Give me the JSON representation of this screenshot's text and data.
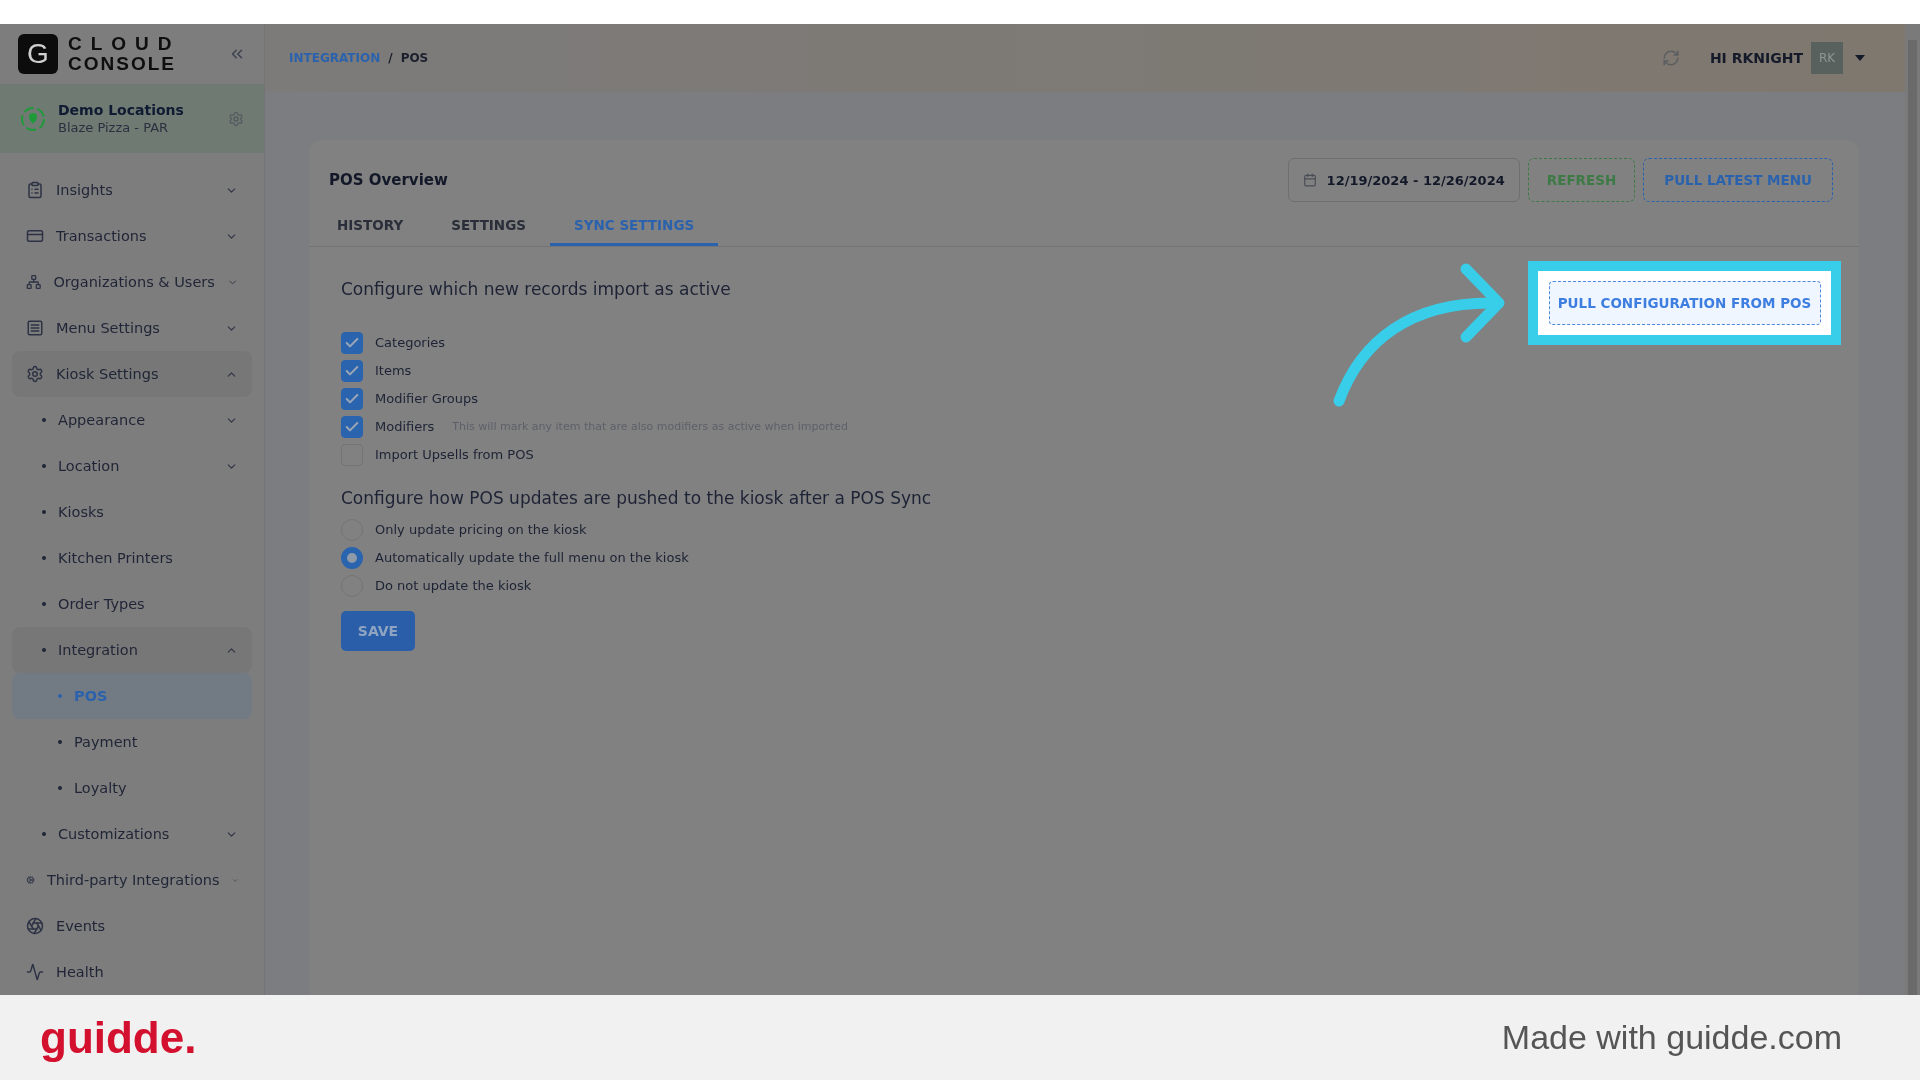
{
  "app": {
    "logo_mark": "G",
    "logo_line1": "CLOUD",
    "logo_line2": "CONSOLE"
  },
  "location": {
    "name": "Demo Locations",
    "subtitle": "Blaze Pizza - PAR"
  },
  "sidebar": {
    "items": [
      {
        "label": "Insights",
        "kind": "group",
        "expanded": false,
        "selected": false
      },
      {
        "label": "Transactions",
        "kind": "group",
        "expanded": false,
        "selected": false
      },
      {
        "label": "Organizations & Users",
        "kind": "group",
        "expanded": false,
        "selected": false
      },
      {
        "label": "Menu Settings",
        "kind": "group",
        "expanded": false,
        "selected": false
      },
      {
        "label": "Kiosk Settings",
        "kind": "group",
        "expanded": true,
        "selected": false,
        "children": [
          {
            "label": "Appearance",
            "kind": "group",
            "expanded": false,
            "selected": false
          },
          {
            "label": "Location",
            "kind": "group",
            "expanded": false,
            "selected": false
          },
          {
            "label": "Kiosks",
            "kind": "link",
            "selected": false
          },
          {
            "label": "Kitchen Printers",
            "kind": "link",
            "selected": false
          },
          {
            "label": "Order Types",
            "kind": "link",
            "selected": false
          },
          {
            "label": "Integration",
            "kind": "group",
            "expanded": true,
            "selected": false,
            "children": [
              {
                "label": "POS",
                "kind": "link",
                "selected": true
              },
              {
                "label": "Payment",
                "kind": "link",
                "selected": false
              },
              {
                "label": "Loyalty",
                "kind": "link",
                "selected": false
              }
            ]
          },
          {
            "label": "Customizations",
            "kind": "group",
            "expanded": false,
            "selected": false
          }
        ]
      },
      {
        "label": "Third-party Integrations",
        "kind": "group",
        "expanded": false,
        "selected": false
      },
      {
        "label": "Events",
        "kind": "link",
        "selected": false
      },
      {
        "label": "Health",
        "kind": "link",
        "selected": false
      }
    ]
  },
  "breadcrumb": [
    {
      "label": "INTEGRATION",
      "link": true
    },
    {
      "label": "/",
      "link": false
    },
    {
      "label": "POS",
      "link": false
    }
  ],
  "user": {
    "greeting": "HI RKNIGHT",
    "initials": "RK"
  },
  "card": {
    "title": "POS Overview",
    "date_range": "12/19/2024 - 12/26/2024",
    "refresh": "REFRESH",
    "pull_menu": "PULL LATEST MENU",
    "tabs": [
      {
        "label": "HISTORY",
        "selected": false
      },
      {
        "label": "SETTINGS",
        "selected": false
      },
      {
        "label": "SYNC SETTINGS",
        "selected": true
      }
    ],
    "pull_config": "PULL CONFIGURATION FROM POS",
    "import_heading": "Configure which new records import as active",
    "imports": [
      {
        "label": "Categories",
        "checked": true
      },
      {
        "label": "Items",
        "checked": true
      },
      {
        "label": "Modifier Groups",
        "checked": true
      },
      {
        "label": "Modifiers",
        "checked": true,
        "hint": "This will mark any item that are also modifiers as active when imported"
      },
      {
        "label": "Import Upsells from POS",
        "checked": false
      }
    ],
    "update_heading": "Configure how POS updates are pushed to the kiosk after a POS Sync",
    "updates": [
      {
        "label": "Only update pricing on the kiosk",
        "selected": false
      },
      {
        "label": "Automatically update the full menu on the kiosk",
        "selected": true
      },
      {
        "label": "Do not update the kiosk",
        "selected": false
      }
    ],
    "save": "SAVE"
  },
  "footer": {
    "brand": "guidde.",
    "credit": "Made with guidde.com"
  }
}
